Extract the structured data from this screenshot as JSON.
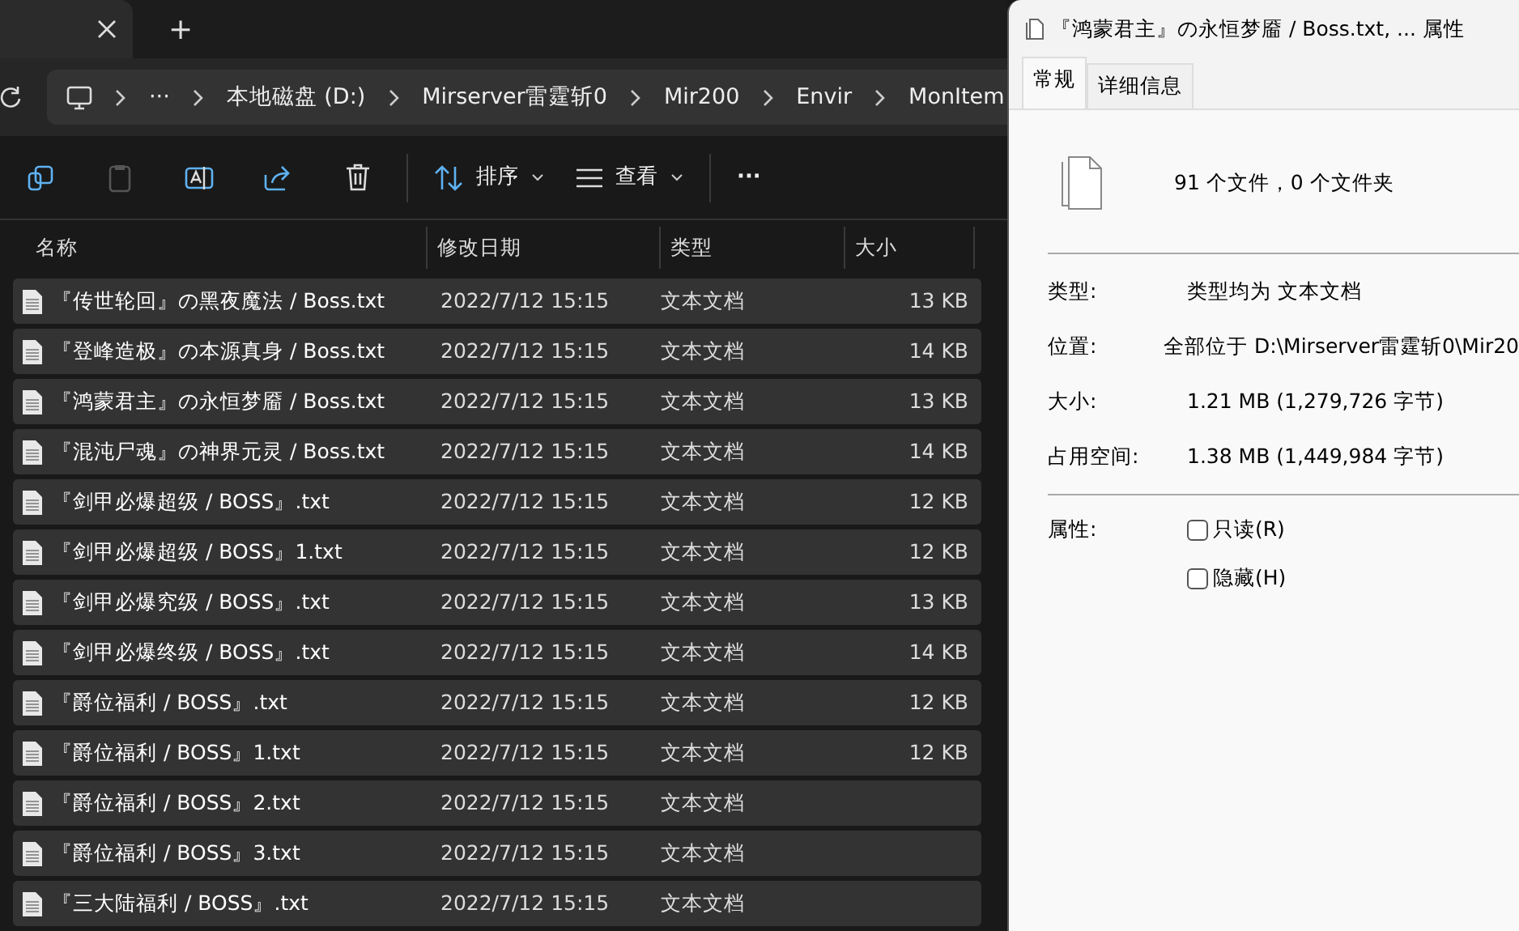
{
  "explorer": {
    "tab_bar": {
      "add_tab": "+"
    },
    "breadcrumb": {
      "more": "···",
      "items": [
        "本地磁盘 (D:)",
        "Mirserver雷霆斩0",
        "Mir200",
        "Envir",
        "MonItem"
      ]
    },
    "toolbar": {
      "sort": "排序",
      "view": "查看",
      "more": "···"
    },
    "table": {
      "columns": [
        "名称",
        "修改日期",
        "类型",
        "大小"
      ],
      "rows": [
        {
          "name": "『传世轮回』の黑夜魔法 / Boss.txt",
          "date": "2022/7/12 15:15",
          "type": "文本文档",
          "size": "13 KB",
          "selected": true
        },
        {
          "name": "『登峰造极』の本源真身 / Boss.txt",
          "date": "2022/7/12 15:15",
          "type": "文本文档",
          "size": "14 KB",
          "selected": true
        },
        {
          "name": "『鸿蒙君主』の永恒梦靥 / Boss.txt",
          "date": "2022/7/12 15:15",
          "type": "文本文档",
          "size": "13 KB",
          "selected": true
        },
        {
          "name": "『混沌尸魂』の神界元灵 / Boss.txt",
          "date": "2022/7/12 15:15",
          "type": "文本文档",
          "size": "14 KB",
          "selected": true
        },
        {
          "name": "『剑甲必爆超级 / BOSS』.txt",
          "date": "2022/7/12 15:15",
          "type": "文本文档",
          "size": "12 KB",
          "selected": true
        },
        {
          "name": "『剑甲必爆超级 / BOSS』1.txt",
          "date": "2022/7/12 15:15",
          "type": "文本文档",
          "size": "12 KB",
          "selected": true
        },
        {
          "name": "『剑甲必爆究级 / BOSS』.txt",
          "date": "2022/7/12 15:15",
          "type": "文本文档",
          "size": "13 KB",
          "selected": true
        },
        {
          "name": "『剑甲必爆终级 / BOSS』.txt",
          "date": "2022/7/12 15:15",
          "type": "文本文档",
          "size": "14 KB",
          "selected": true
        },
        {
          "name": "『爵位福利 / BOSS』.txt",
          "date": "2022/7/12 15:15",
          "type": "文本文档",
          "size": "12 KB",
          "selected": true
        },
        {
          "name": "『爵位福利 / BOSS』1.txt",
          "date": "2022/7/12 15:15",
          "type": "文本文档",
          "size": "12 KB",
          "selected": true
        },
        {
          "name": "『爵位福利 / BOSS』2.txt",
          "date": "2022/7/12 15:15",
          "type": "文本文档",
          "selected": true
        },
        {
          "name": "『爵位福利 / BOSS』3.txt",
          "date": "2022/7/12 15:15",
          "type": "文本文档",
          "selected": true
        },
        {
          "name": "『三大陆福利 / BOSS』.txt",
          "date": "2022/7/12 15:15",
          "type": "文本文档",
          "selected": true
        }
      ]
    }
  },
  "properties_dialog": {
    "title": "『鸿蒙君主』の永恒梦靥 / Boss.txt, ... 属性",
    "tabs": [
      {
        "label": "常规",
        "selected": true
      },
      {
        "label": "详细信息",
        "selected": false
      }
    ],
    "summary": "91 个文件，0 个文件夹",
    "fields": [
      {
        "label": "类型:",
        "value": "类型均为 文本文档"
      },
      {
        "label": "位置:",
        "value": "全部位于 D:\\Mirserver雷霆斩0\\Mir20"
      },
      {
        "label": "大小:",
        "value": "1.21 MB (1,279,726 字节)"
      },
      {
        "label": "占用空间:",
        "value": "1.38 MB (1,449,984 字节)"
      }
    ],
    "attributes_label": "属性:",
    "attributes": [
      {
        "label": "只读(R)",
        "checked": false
      },
      {
        "label": "隐藏(H)",
        "checked": false
      }
    ]
  }
}
